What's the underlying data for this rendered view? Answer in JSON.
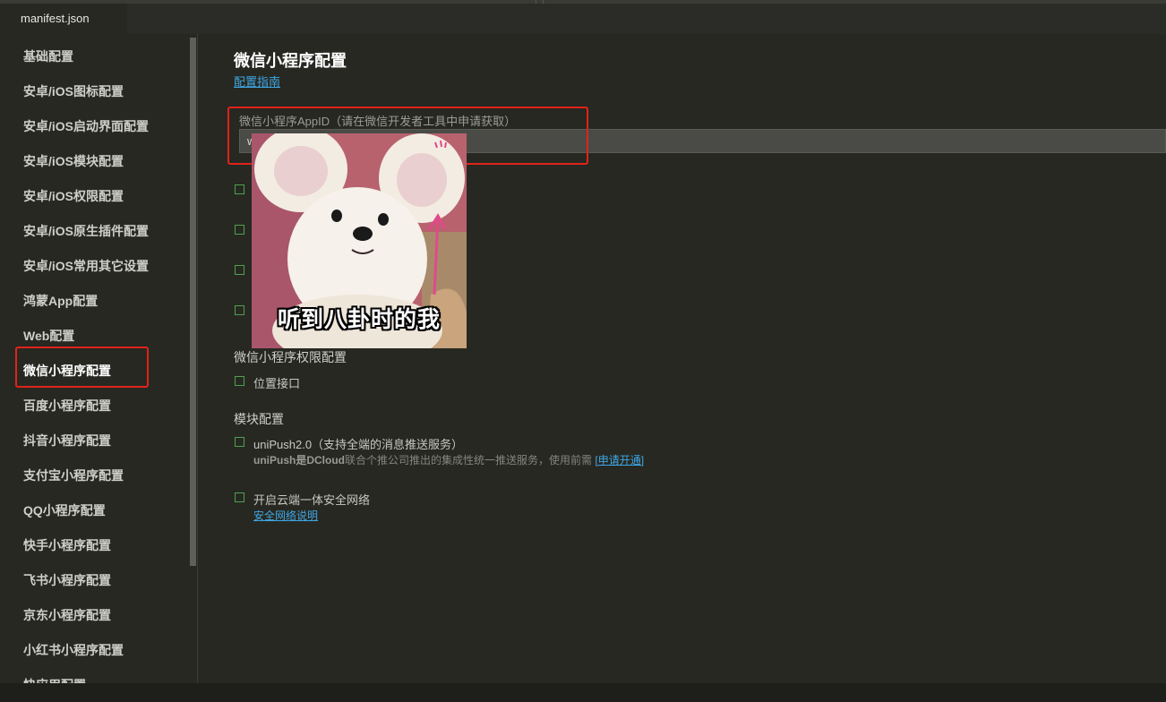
{
  "tab": {
    "title": "manifest.json"
  },
  "sidebar": {
    "items": [
      {
        "label": "基础配置"
      },
      {
        "label": "安卓/iOS图标配置"
      },
      {
        "label": "安卓/iOS启动界面配置"
      },
      {
        "label": "安卓/iOS模块配置"
      },
      {
        "label": "安卓/iOS权限配置"
      },
      {
        "label": "安卓/iOS原生插件配置"
      },
      {
        "label": "安卓/iOS常用其它设置"
      },
      {
        "label": "鸿蒙App配置"
      },
      {
        "label": "Web配置"
      },
      {
        "label": "微信小程序配置",
        "active": true
      },
      {
        "label": "百度小程序配置"
      },
      {
        "label": "抖音小程序配置"
      },
      {
        "label": "支付宝小程序配置"
      },
      {
        "label": "QQ小程序配置"
      },
      {
        "label": "快手小程序配置"
      },
      {
        "label": "飞书小程序配置"
      },
      {
        "label": "京东小程序配置"
      },
      {
        "label": "小红书小程序配置"
      },
      {
        "label": "快应用配置"
      }
    ]
  },
  "main": {
    "title": "微信小程序配置",
    "guide_link": "配置指南",
    "appid": {
      "label": "微信小程序AppID（请在微信开发者工具中申请获取）",
      "value": "w"
    },
    "permissions": {
      "title": "微信小程序权限配置",
      "location_label": "位置接口"
    },
    "modules": {
      "title": "模块配置",
      "unipush_label": "uniPush2.0（支持全端的消息推送服务）",
      "unipush_desc_bold": "uniPush是DCloud",
      "unipush_desc_rest": "联合个推公司推出的集成性统一推送服务，使用前需",
      "unipush_apply_link": "[申请开通]",
      "security_label": "开启云端一体安全网络",
      "security_link": "安全网络说明"
    }
  },
  "meme": {
    "caption": "听到八卦时的我"
  },
  "colors": {
    "accent_link": "#3fa7e5",
    "highlight_box": "#e0231a",
    "checkbox": "#4fa04f",
    "background": "#272822"
  }
}
